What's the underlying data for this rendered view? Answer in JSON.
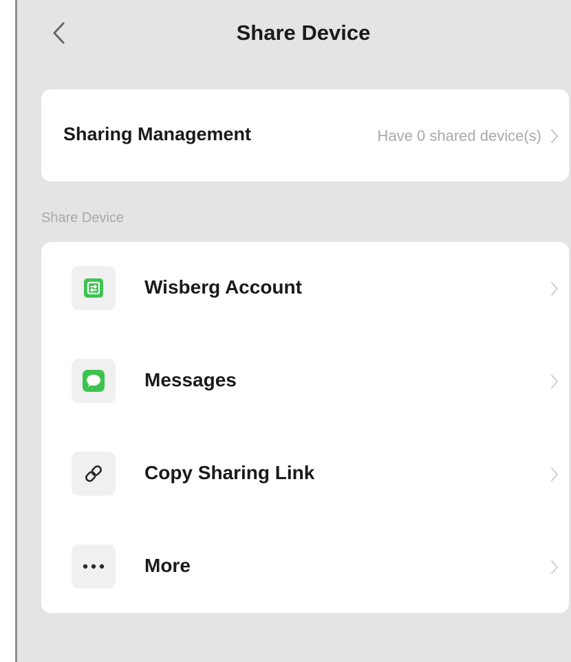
{
  "header": {
    "title": "Share Device",
    "back_icon": "chevron-left-icon"
  },
  "management": {
    "label": "Sharing Management",
    "value": "Have 0 shared device(s)"
  },
  "share_section": {
    "label": "Share Device",
    "items": [
      {
        "label": "Wisberg Account",
        "icon": "app-account-icon"
      },
      {
        "label": "Messages",
        "icon": "messages-icon"
      },
      {
        "label": "Copy Sharing Link",
        "icon": "link-icon"
      },
      {
        "label": "More",
        "icon": "more-icon"
      }
    ]
  },
  "colors": {
    "background": "#e4e4e4",
    "card": "#ffffff",
    "accent_green": "#3cc44f",
    "text_primary": "#1a1a1a",
    "text_secondary": "#a9a9a9"
  }
}
